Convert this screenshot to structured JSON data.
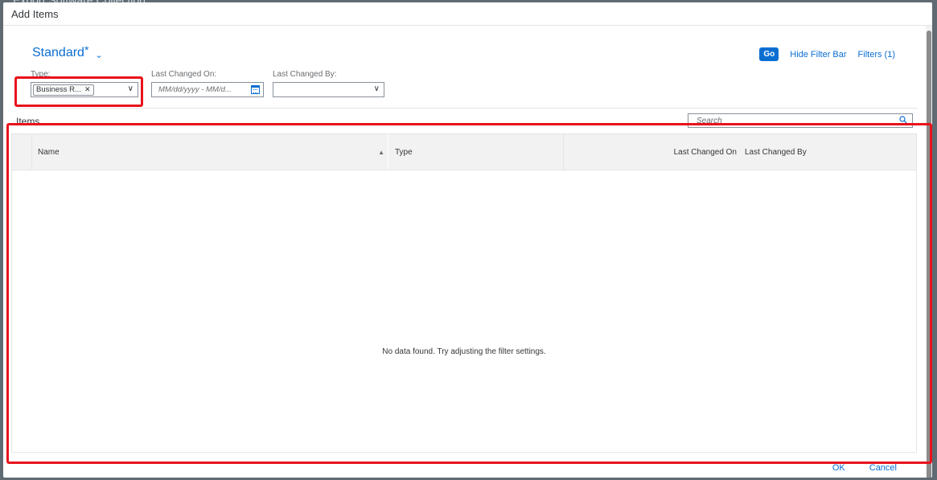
{
  "background": {
    "title": "Export Software Collection"
  },
  "dialog": {
    "title": "Add Items",
    "variant": {
      "name": "Standard",
      "modified_marker": "*"
    },
    "filter_bar": {
      "go_label": "Go",
      "hide_label": "Hide Filter Bar",
      "filters_label": "Filters (1)",
      "filters": [
        {
          "label": "Type:",
          "token": "Business R..."
        },
        {
          "label": "Last Changed On:",
          "placeholder": "MM/dd/yyyy - MM/d..."
        },
        {
          "label": "Last Changed By:",
          "value": ""
        }
      ]
    },
    "items": {
      "title": "Items",
      "search_placeholder": "Search",
      "columns": [
        "Name",
        "Type",
        "Last Changed On",
        "Last Changed By"
      ],
      "sorted_column": "Name",
      "rows": [],
      "empty_text": "No data found. Try adjusting the filter settings."
    },
    "footer": {
      "ok_label": "OK",
      "cancel_label": "Cancel"
    }
  },
  "colors": {
    "accent": "#0a6ed1",
    "highlight": "#e8131b"
  }
}
